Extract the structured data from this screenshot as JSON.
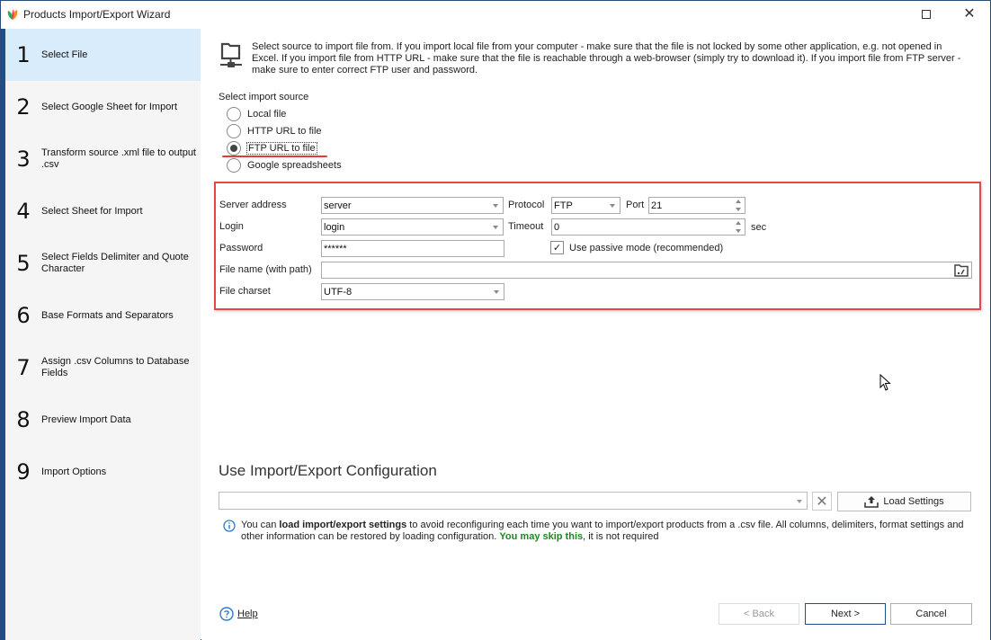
{
  "window": {
    "title": "Products Import/Export Wizard",
    "controls": [
      "maximize-icon",
      "close-icon"
    ]
  },
  "sidebar": {
    "steps": [
      {
        "num": "1",
        "label": "Select File",
        "active": true
      },
      {
        "num": "2",
        "label": "Select Google Sheet for Import",
        "active": false
      },
      {
        "num": "3",
        "label": "Transform source .xml file to output .csv",
        "active": false
      },
      {
        "num": "4",
        "label": "Select Sheet for Import",
        "active": false
      },
      {
        "num": "5",
        "label": "Select Fields Delimiter and Quote Character",
        "active": false
      },
      {
        "num": "6",
        "label": "Base Formats and Separators",
        "active": false
      },
      {
        "num": "7",
        "label": "Assign .csv Columns to Database Fields",
        "active": false
      },
      {
        "num": "8",
        "label": "Preview Import Data",
        "active": false
      },
      {
        "num": "9",
        "label": "Import Options",
        "active": false
      }
    ]
  },
  "main": {
    "hint_icon": "network-folder-icon",
    "hint_text": "Select source to import file from. If you import local file from your computer - make sure that the file is not locked by some other application, e.g. not opened in Excel. If you import file from HTTP URL - make sure that the file is reachable through a web-browser (simply try to download it). If you import file from FTP server - make sure to enter correct FTP user and password.",
    "source_label": "Select import source",
    "sources": [
      {
        "label": "Local file",
        "selected": false
      },
      {
        "label": "HTTP URL to file",
        "selected": false
      },
      {
        "label": "FTP URL to file",
        "selected": true
      },
      {
        "label": "Google spreadsheets",
        "selected": false
      }
    ],
    "ftp": {
      "server_label": "Server address",
      "server_value": "server",
      "protocol_label": "Protocol",
      "protocol_value": "FTP",
      "port_label": "Port",
      "port_value": "21",
      "login_label": "Login",
      "login_value": "login",
      "timeout_label": "Timeout",
      "timeout_value": "0",
      "timeout_unit": "sec",
      "password_label": "Password",
      "password_value": "******",
      "passive_label": "Use passive mode (recommended)",
      "passive_checked": true,
      "filename_label": "File name (with path)",
      "filename_value": "",
      "charset_label": "File charset",
      "charset_value": "UTF-8"
    },
    "config": {
      "title": "Use Import/Export Configuration",
      "combo_value": "",
      "clear_label": "✕",
      "load_label": "Load Settings",
      "info_pre": "You can ",
      "info_bold": "load import/export settings",
      "info_mid": " to avoid reconfiguring each time you want to import/export products from a .csv file. All columns, delimiters, format settings and other information can be restored by loading configuration. ",
      "info_green": "You may skip this",
      "info_post": ", it is not required"
    }
  },
  "footer": {
    "help_label": "Help",
    "back_label": "< Back",
    "next_label": "Next >",
    "cancel_label": "Cancel"
  },
  "colors": {
    "accent": "#1e4e8c",
    "active_step_bg": "#d9ecfb",
    "highlight_red": "#e94545",
    "green_text": "#1d8a1d"
  }
}
